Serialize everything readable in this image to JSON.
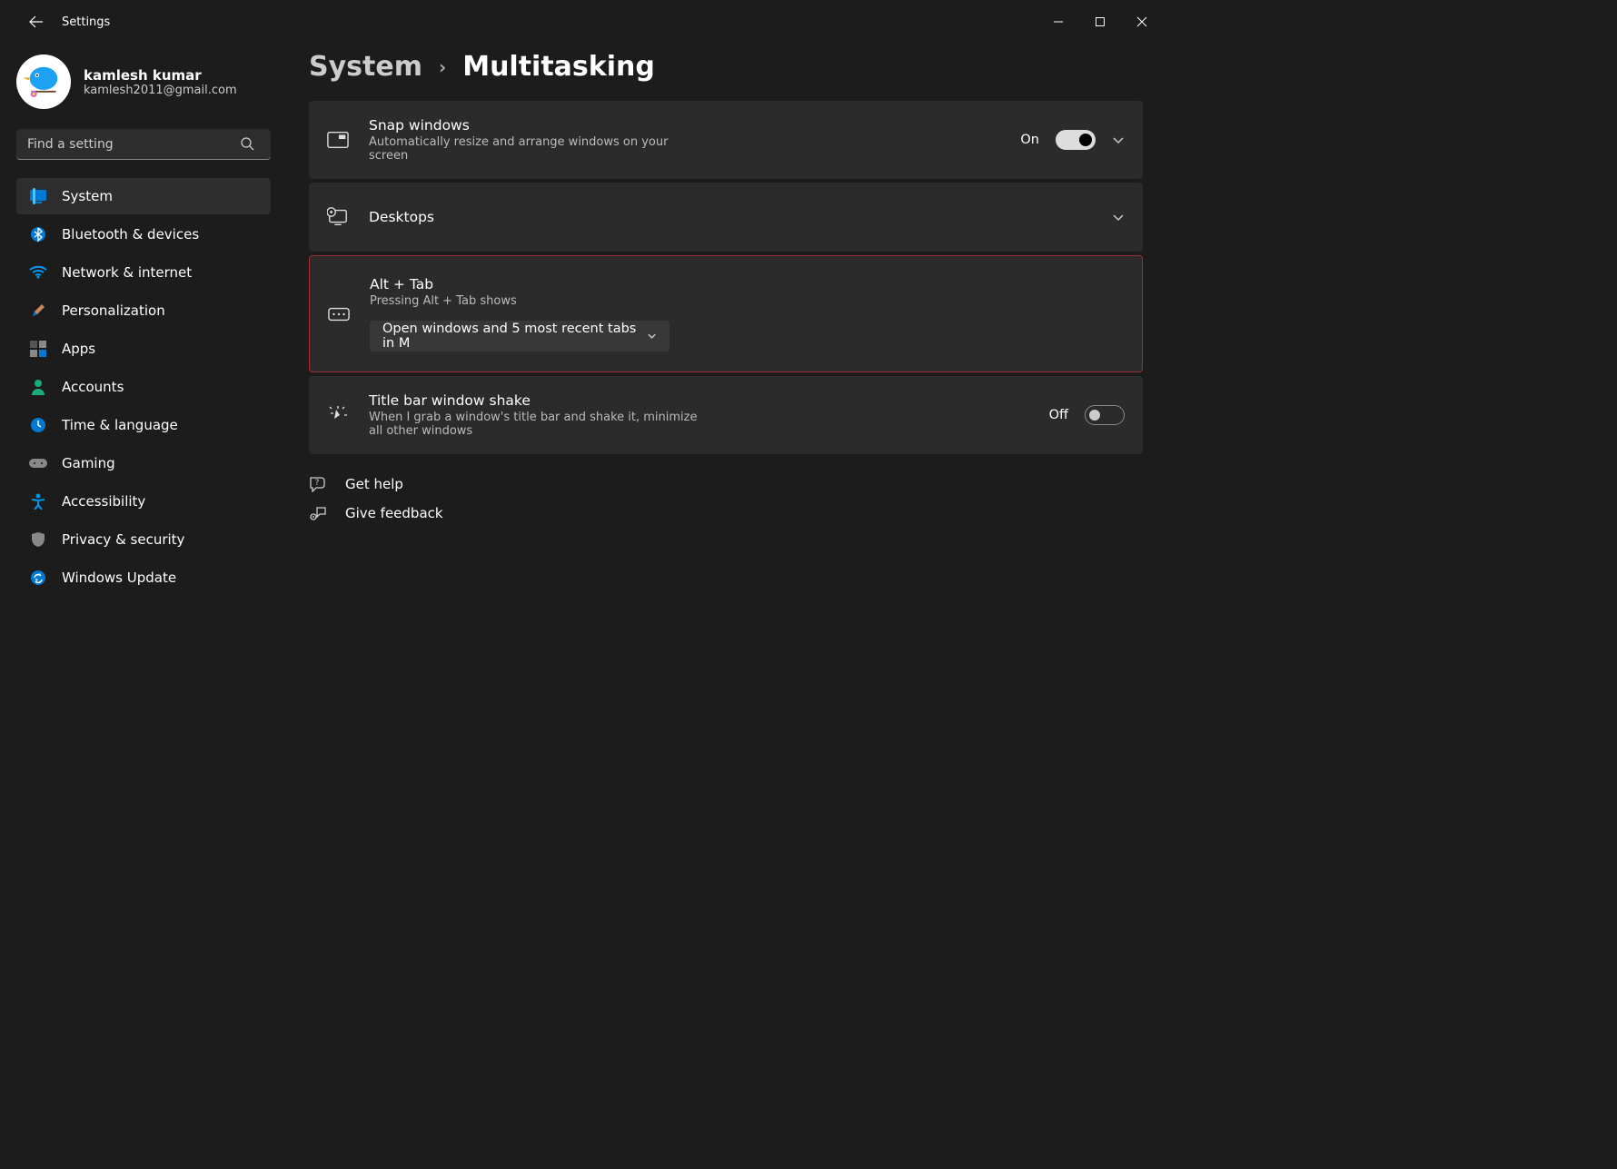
{
  "titlebar": {
    "app_title": "Settings"
  },
  "profile": {
    "name": "kamlesh kumar",
    "email": "kamlesh2011@gmail.com"
  },
  "search": {
    "placeholder": "Find a setting"
  },
  "nav": {
    "items": [
      {
        "label": "System"
      },
      {
        "label": "Bluetooth & devices"
      },
      {
        "label": "Network & internet"
      },
      {
        "label": "Personalization"
      },
      {
        "label": "Apps"
      },
      {
        "label": "Accounts"
      },
      {
        "label": "Time & language"
      },
      {
        "label": "Gaming"
      },
      {
        "label": "Accessibility"
      },
      {
        "label": "Privacy & security"
      },
      {
        "label": "Windows Update"
      }
    ]
  },
  "breadcrumb": {
    "parent": "System",
    "current": "Multitasking"
  },
  "cards": {
    "snap": {
      "title": "Snap windows",
      "desc": "Automatically resize and arrange windows on your screen",
      "state": "On"
    },
    "desktops": {
      "title": "Desktops"
    },
    "alttab": {
      "title": "Alt + Tab",
      "desc": "Pressing Alt + Tab shows",
      "selected": "Open windows and 5 most recent tabs in M"
    },
    "shake": {
      "title": "Title bar window shake",
      "desc": "When I grab a window's title bar and shake it, minimize all other windows",
      "state": "Off"
    }
  },
  "footer": {
    "help": "Get help",
    "feedback": "Give feedback"
  }
}
